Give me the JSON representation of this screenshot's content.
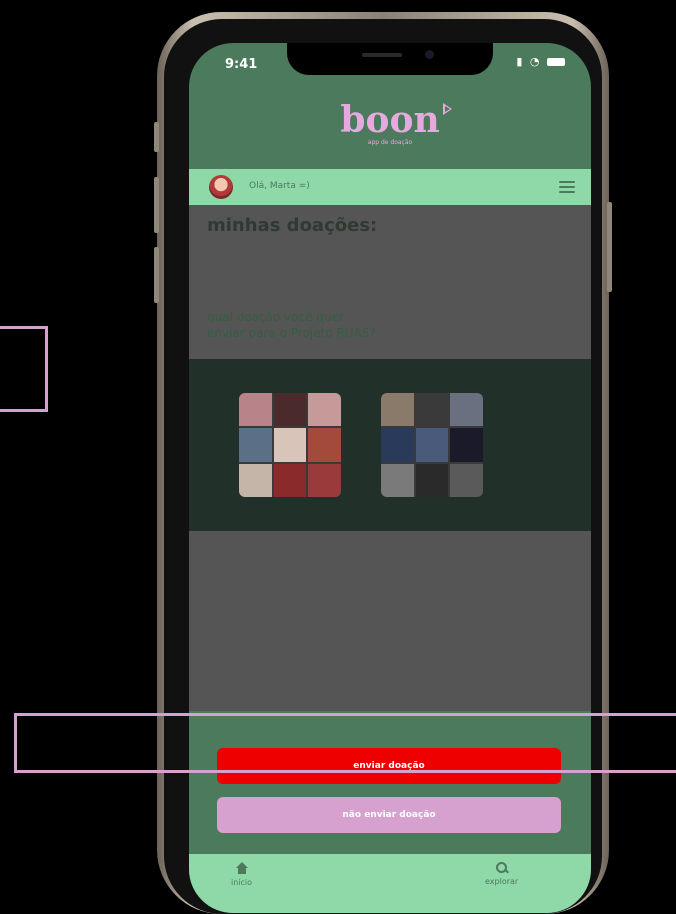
{
  "status": {
    "time": "9:41"
  },
  "brand": {
    "title": "boon",
    "subtitle": "app de doação"
  },
  "user": {
    "greeting": "Olá, Marta =)"
  },
  "main": {
    "title": "minhas doações:",
    "question_line1": "qual doação você quer",
    "question_line2": "enviar para o Projeto RUAS?"
  },
  "actions": {
    "send_label": "enviar doação",
    "no_send_label": "não enviar doação"
  },
  "tabbar": {
    "home_label": "início",
    "explore_label": "explorar"
  },
  "colors": {
    "green": "#4b7a5c",
    "mint": "#8fd9a9",
    "pink": "#e6a9dd",
    "red": "#ee0000"
  }
}
